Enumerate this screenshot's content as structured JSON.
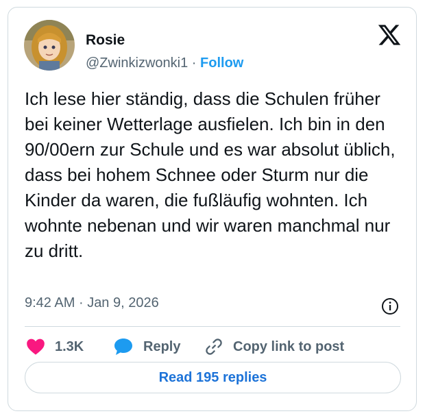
{
  "author": {
    "name": "Rosie",
    "handle": "@Zwinkizwonki1",
    "separator": "·",
    "follow_label": "Follow"
  },
  "tweet": {
    "text": "Ich lese hier ständig, dass die Schulen früher bei keiner Wetterlage ausfielen. Ich bin in den 90/00ern zur Schule und es war absolut üblich, dass bei hohem Schnee oder Sturm nur die Kinder da waren, die fußläufig wohnten. Ich wohnte nebenan und wir waren manchmal nur zu dritt.",
    "time": "9:42 AM",
    "date_separator": "·",
    "date": "Jan 9, 2026"
  },
  "actions": {
    "likes_count": "1.3K",
    "reply_label": "Reply",
    "copy_link_label": "Copy link to post"
  },
  "read_replies_label": "Read 195 replies",
  "colors": {
    "accent": "#1d9bf0",
    "like": "#f91880",
    "reply_bubble": "#1d9bf0",
    "muted": "#536471",
    "border": "#cfd9de"
  },
  "icons": {
    "brand": "x-logo-icon",
    "info": "info-icon",
    "like": "heart-icon",
    "reply": "speech-bubble-icon",
    "copy": "link-icon"
  }
}
